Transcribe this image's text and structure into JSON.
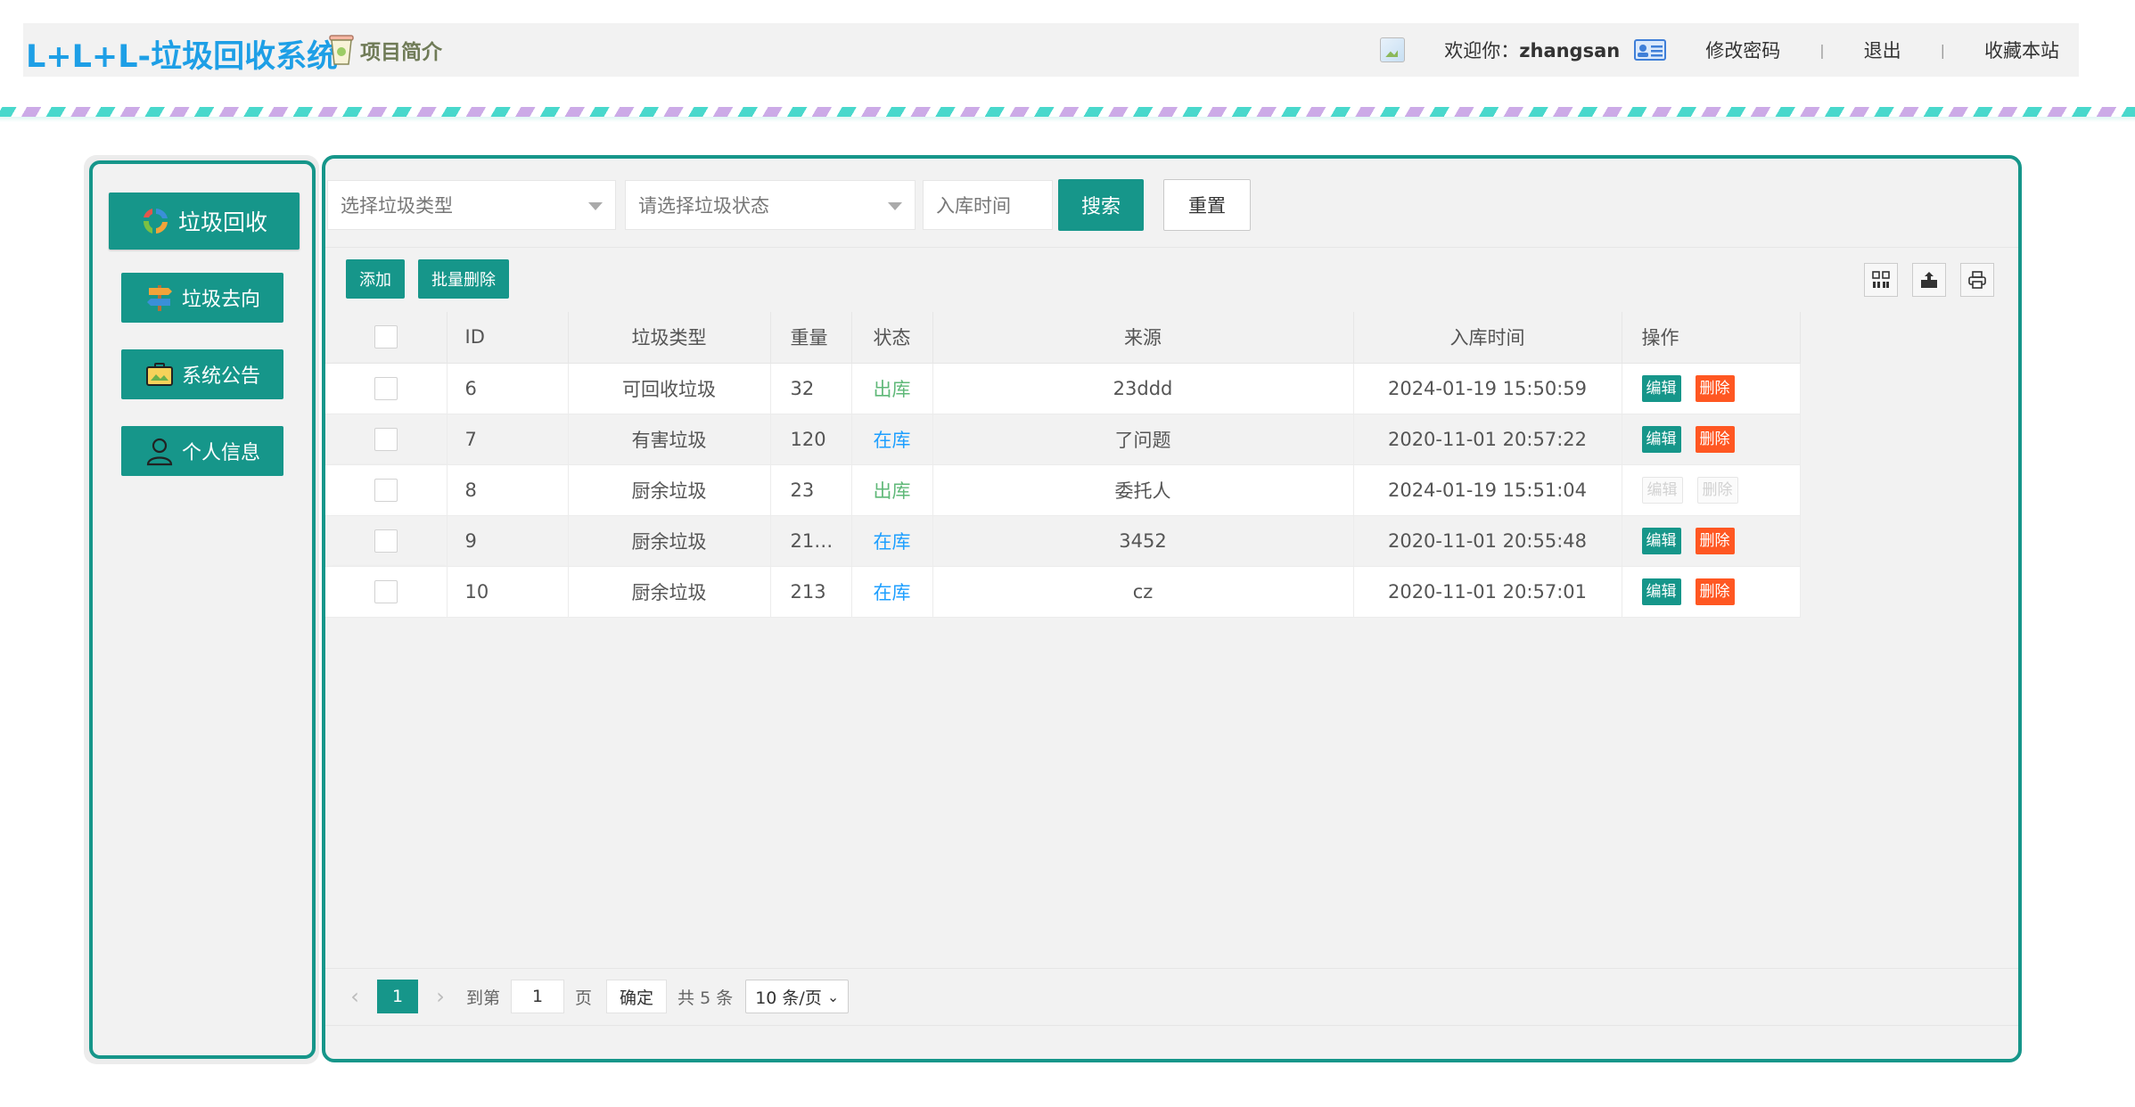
{
  "header": {
    "brand": "L+L+L-垃圾回收系统",
    "intro_label": "项目简介",
    "welcome_prefix": "欢迎你：",
    "username": "zhangsan",
    "change_password": "修改密码",
    "logout": "退出",
    "bookmark": "收藏本站",
    "separator": "|"
  },
  "sidebar": {
    "items": [
      {
        "label": "垃圾回收",
        "icon": "recycle-icon"
      },
      {
        "label": "垃圾去向",
        "icon": "signpost-icon"
      },
      {
        "label": "系统公告",
        "icon": "briefcase-icon"
      },
      {
        "label": "个人信息",
        "icon": "user-icon"
      }
    ]
  },
  "filters": {
    "type_placeholder": "选择垃圾类型",
    "status_placeholder": "请选择垃圾状态",
    "time_placeholder": "入库时间",
    "search_label": "搜索",
    "reset_label": "重置"
  },
  "toolbar": {
    "add_label": "添加",
    "batch_delete_label": "批量删除",
    "icons": [
      "columns-icon",
      "export-icon",
      "print-icon"
    ]
  },
  "table": {
    "columns": [
      "ID",
      "垃圾类型",
      "重量",
      "状态",
      "来源",
      "入库时间",
      "操作"
    ],
    "edit_label": "编辑",
    "delete_label": "删除",
    "rows": [
      {
        "id": "6",
        "type": "可回收垃圾",
        "weight": "32",
        "status": "出库",
        "source": "23ddd",
        "time": "2024-01-19 15:50:59",
        "ops_enabled": true
      },
      {
        "id": "7",
        "type": "有害垃圾",
        "weight": "120",
        "status": "在库",
        "source": "了问题",
        "time": "2020-11-01 20:57:22",
        "ops_enabled": true
      },
      {
        "id": "8",
        "type": "厨余垃圾",
        "weight": "23",
        "status": "出库",
        "source": "委托人",
        "time": "2024-01-19 15:51:04",
        "ops_enabled": false
      },
      {
        "id": "9",
        "type": "厨余垃圾",
        "weight": "21…",
        "status": "在库",
        "source": "3452",
        "time": "2020-11-01 20:55:48",
        "ops_enabled": true
      },
      {
        "id": "10",
        "type": "厨余垃圾",
        "weight": "213",
        "status": "在库",
        "source": "cz",
        "time": "2020-11-01 20:57:01",
        "ops_enabled": true
      }
    ]
  },
  "pagination": {
    "current_page": "1",
    "goto_prefix": "到第",
    "goto_value": "1",
    "goto_suffix": "页",
    "confirm_label": "确定",
    "total_text": "共 5 条",
    "page_size": "10 条/页"
  },
  "colors": {
    "brand_blue": "#1e9fe6",
    "primary_teal": "#16968a",
    "danger": "#ff5722",
    "status_out": "#5fb878",
    "status_in": "#1e9fff"
  }
}
